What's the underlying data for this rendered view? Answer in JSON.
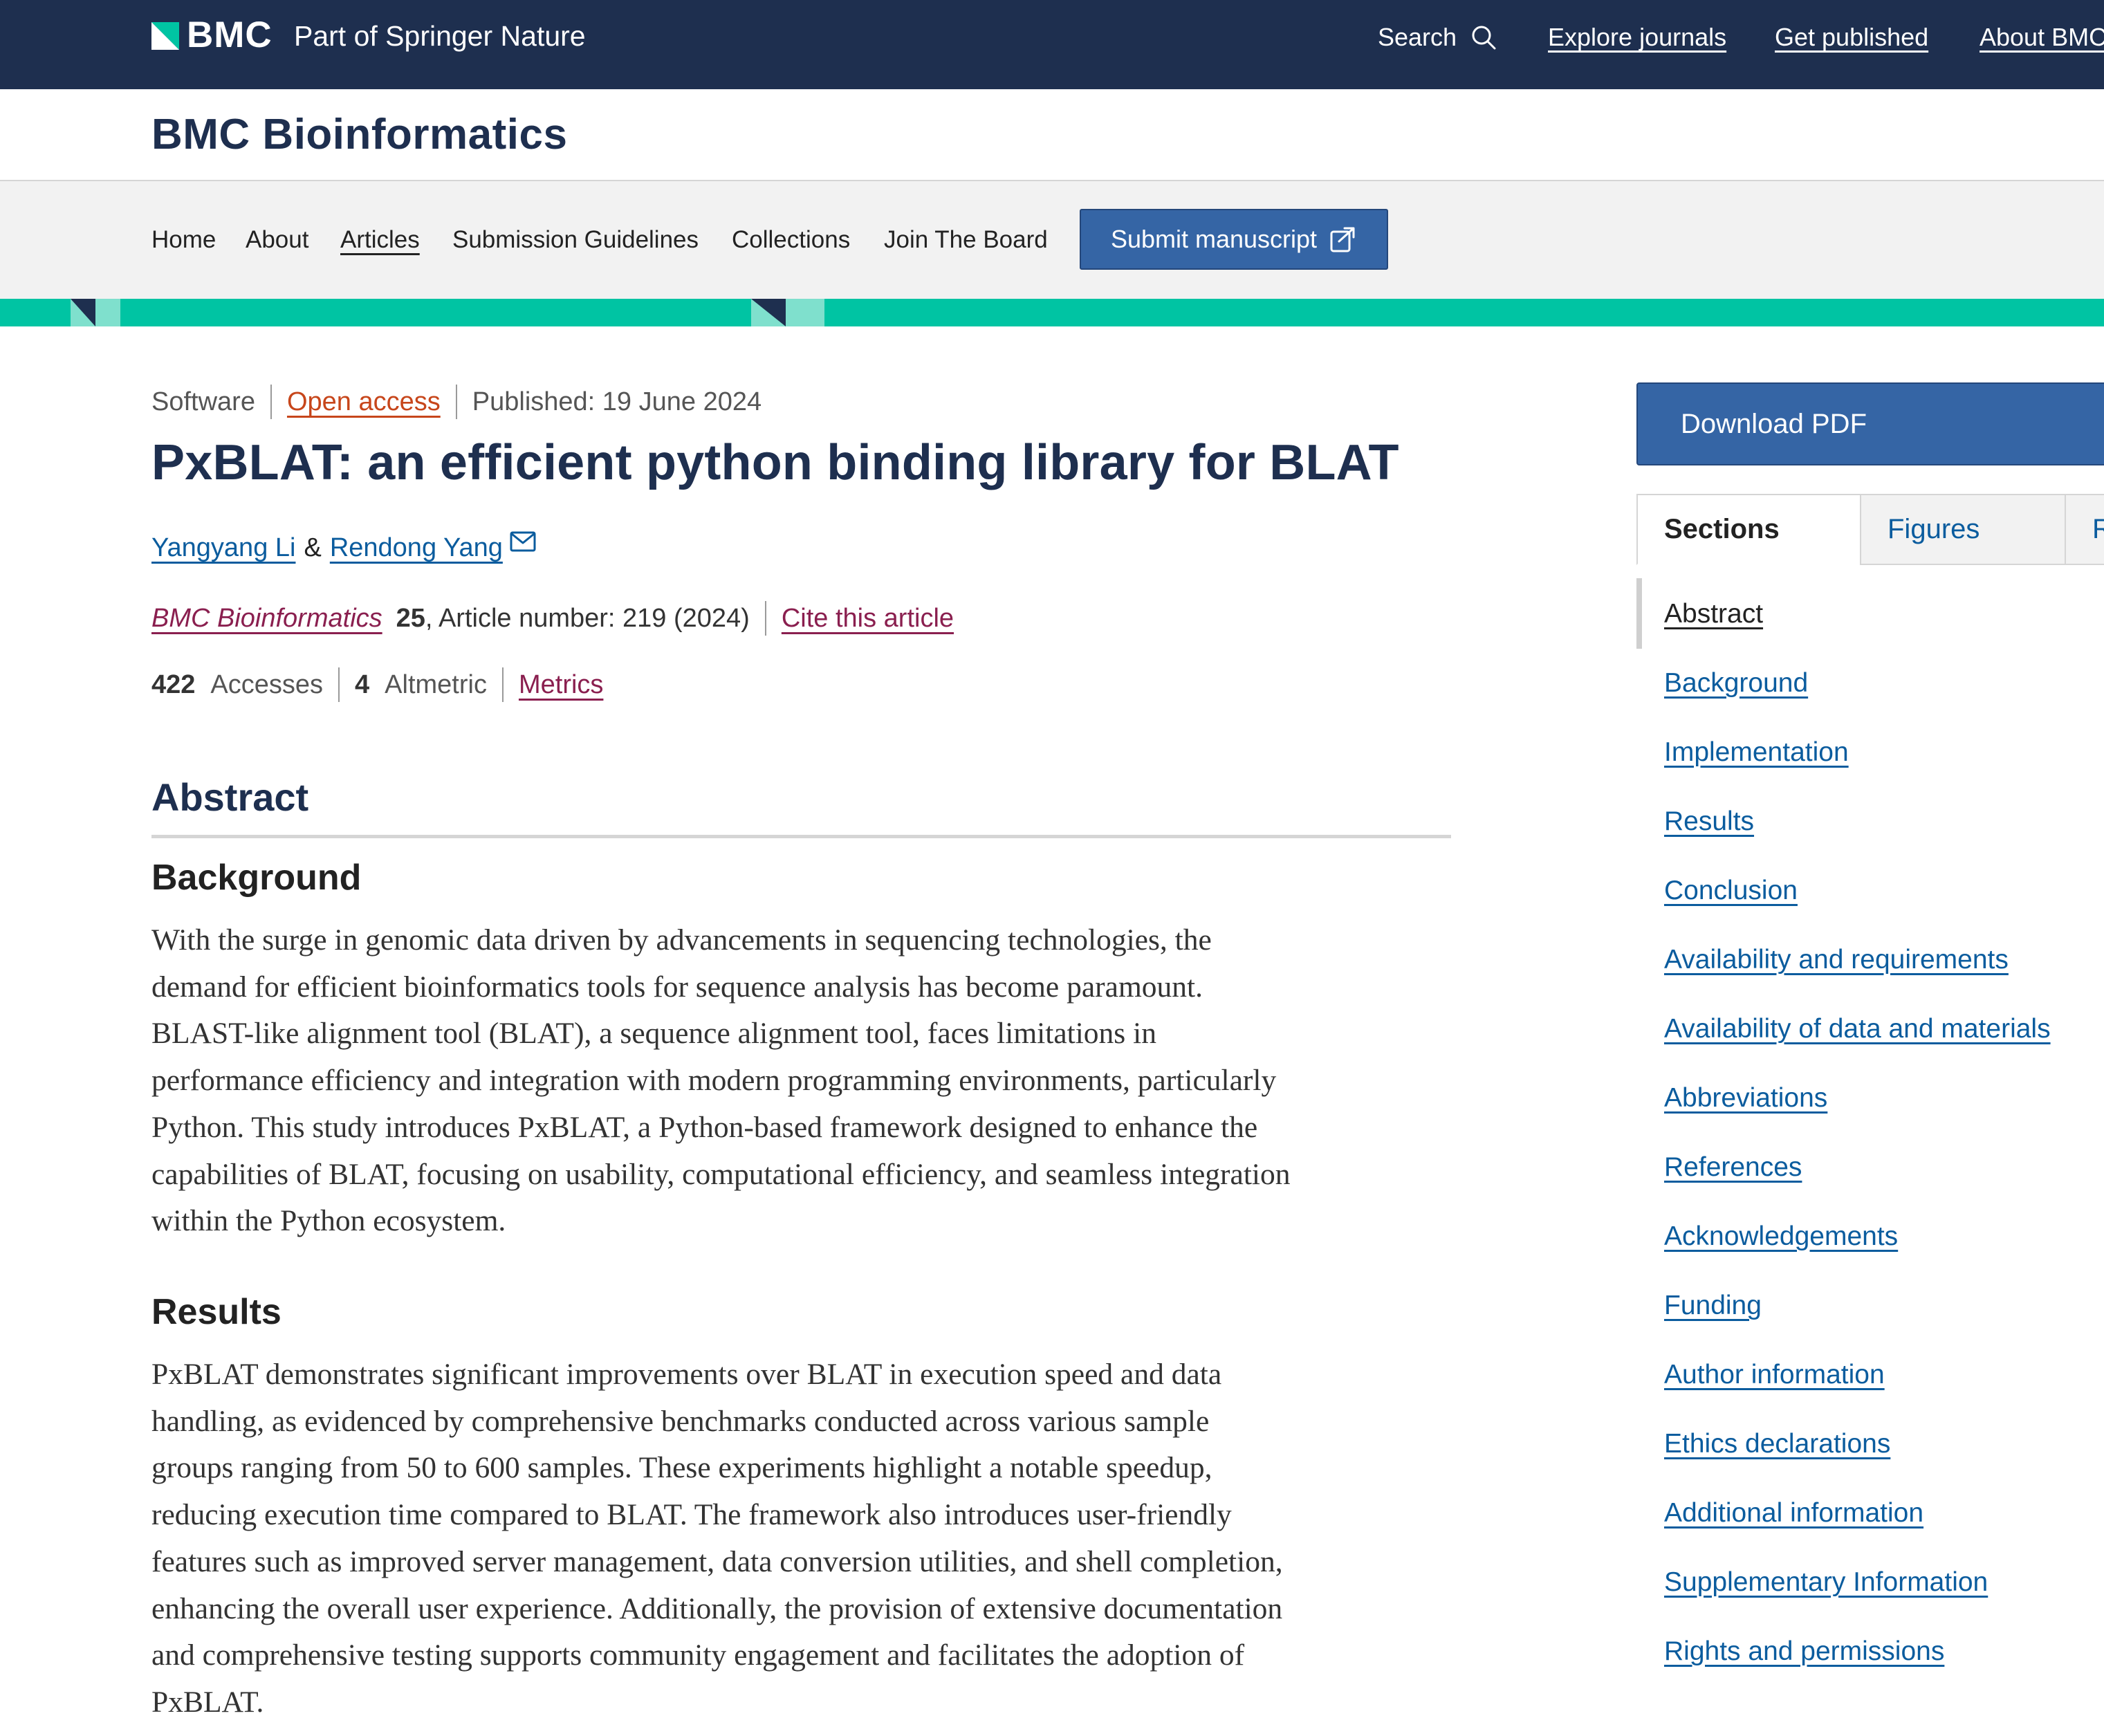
{
  "topbar": {
    "brand": "BMC",
    "tagline": "Part of Springer Nature",
    "search_label": "Search",
    "links": [
      "Explore journals",
      "Get published",
      "About BMC"
    ],
    "bg_color": "#1e2f4f"
  },
  "journal": {
    "title": "BMC Bioinformatics"
  },
  "nav": {
    "items": [
      "Home",
      "About",
      "Articles",
      "Submission Guidelines",
      "Collections",
      "Join The Board"
    ],
    "submit_label": "Submit manuscript",
    "accent_color": "#00c4a3"
  },
  "article": {
    "type": "Software",
    "access": "Open access",
    "published": "Published: 19 June 2024",
    "title": "PxBLAT: an efficient python binding library for BLAT",
    "authors": [
      "Yangyang Li",
      "Rendong Yang"
    ],
    "author_joiner": "&",
    "journal_name": "BMC Bioinformatics",
    "volume": "25",
    "article_number": ", Article number: 219 (2024)",
    "cite_label": "Cite this article",
    "accesses_count": "422",
    "accesses_label": "Accesses",
    "altmetric_count": "4",
    "altmetric_label": "Altmetric",
    "metrics_label": "Metrics"
  },
  "abstract": {
    "heading": "Abstract",
    "background_heading": "Background",
    "background_lines": [
      "With the surge in genomic data driven by advancements in sequencing technologies, the",
      "demand for efficient bioinformatics tools for sequence analysis has become paramount.",
      "BLAST-like alignment tool (BLAT), a sequence alignment tool, faces limitations in",
      "performance efficiency and integration with modern programming environments, particularly",
      "Python. This study introduces PxBLAT, a Python-based framework designed to enhance the",
      "capabilities of BLAT, focusing on usability, computational efficiency, and seamless integration",
      "within the Python ecosystem."
    ],
    "results_heading": "Results",
    "results_lines": [
      "PxBLAT demonstrates significant improvements over BLAT in execution speed and data",
      "handling, as evidenced by comprehensive benchmarks conducted across various sample",
      "groups ranging from 50 to 600 samples. These experiments highlight a notable speedup,",
      "reducing execution time compared to BLAT. The framework also introduces user-friendly",
      "features such as improved server management, data conversion utilities, and shell completion,",
      "enhancing the overall user experience. Additionally, the provision of extensive documentation",
      "and comprehensive testing supports community engagement and facilitates the adoption of",
      "PxBLAT."
    ]
  },
  "sidebar": {
    "download_label": "Download PDF",
    "tabs": [
      "Sections",
      "Figures",
      "R"
    ],
    "sections": [
      "Abstract",
      "Background",
      "Implementation",
      "Results",
      "Conclusion",
      "Availability and requirements",
      "Availability of data and materials",
      "Abbreviations",
      "References",
      "Acknowledgements",
      "Funding",
      "Author information",
      "Ethics declarations",
      "Additional information",
      "Supplementary Information",
      "Rights and permissions"
    ]
  }
}
